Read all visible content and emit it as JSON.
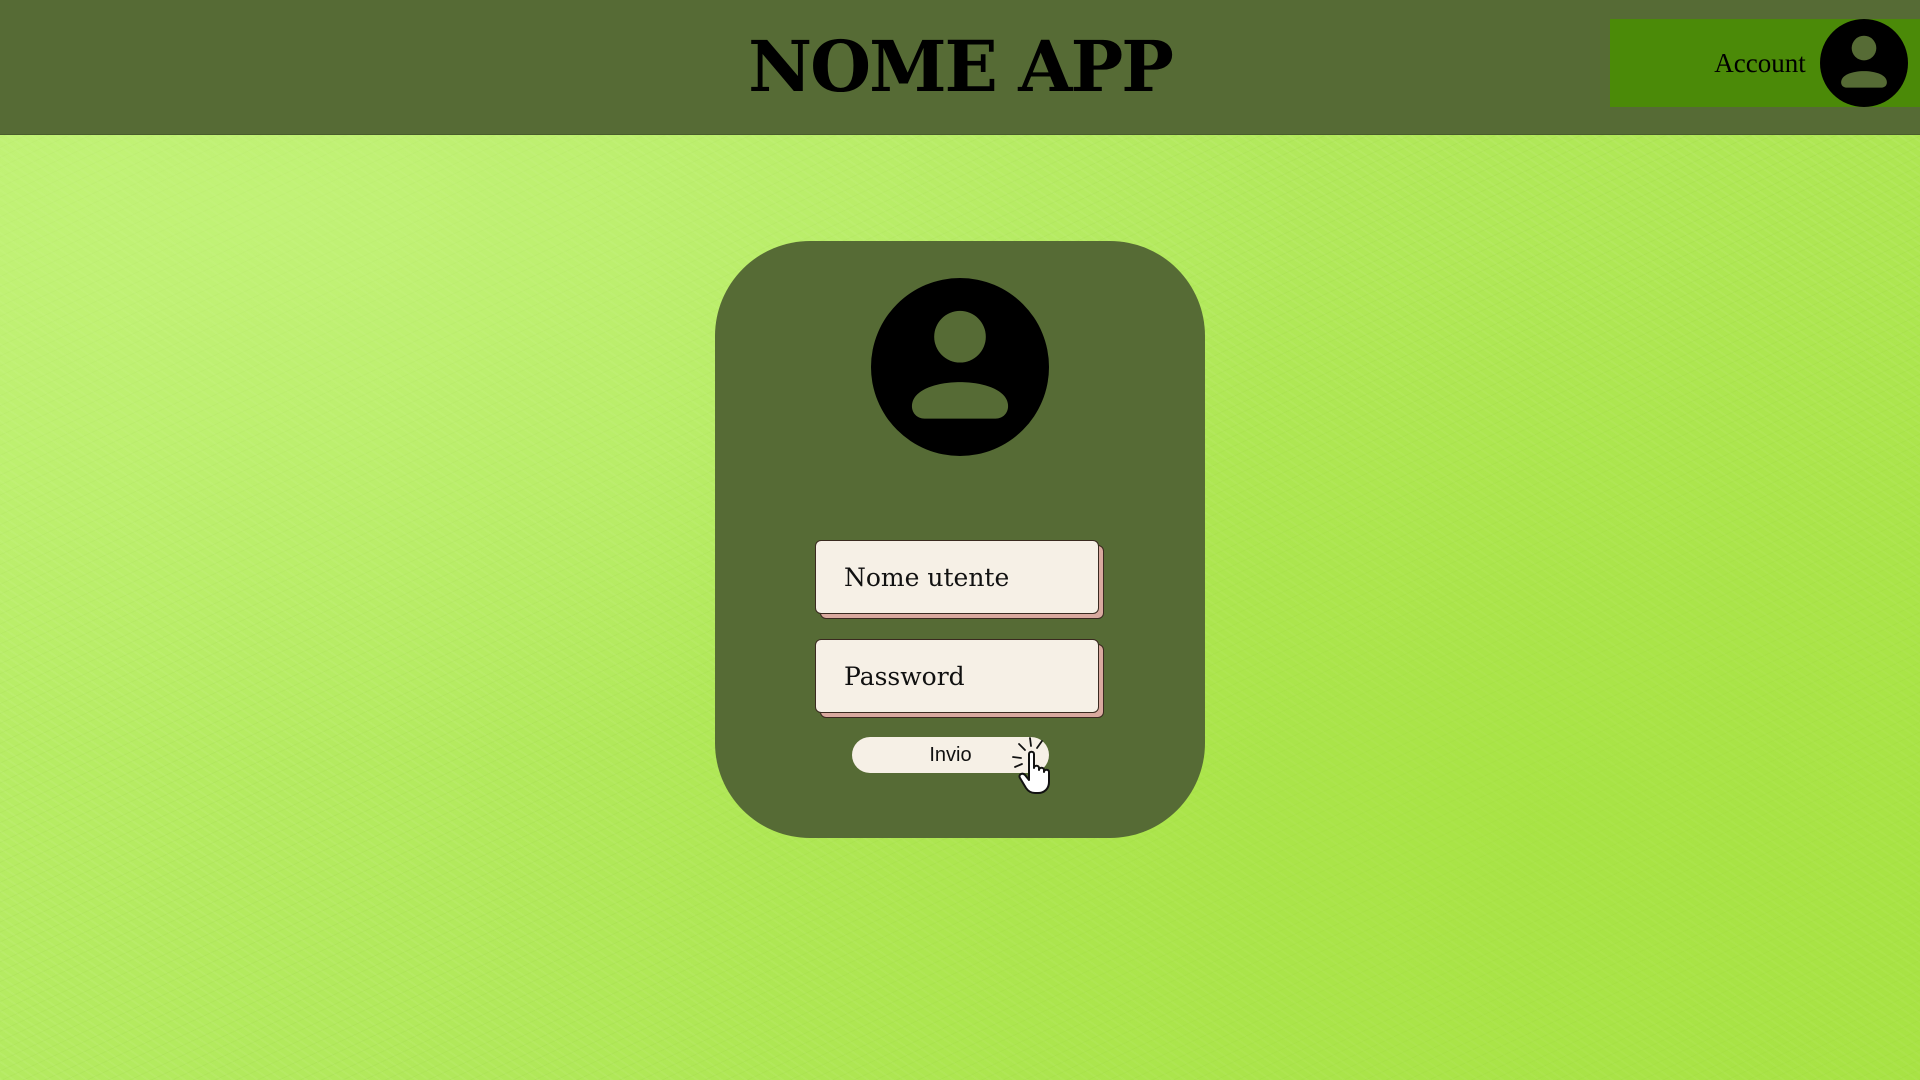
{
  "header": {
    "app_title": "NOME APP",
    "account_label": "Account",
    "account_icon": "user-avatar-icon"
  },
  "login": {
    "avatar_icon": "user-avatar-icon",
    "username_placeholder": "Nome utente",
    "password_placeholder": "Password",
    "submit_label": "Invio",
    "cursor_icon": "pointer-hand-click-icon"
  },
  "colors": {
    "background": "#b3e65a",
    "header_bg": "#566b35",
    "card_bg": "#566b35",
    "account_bg": "#4b8a08",
    "field_bg": "#f6f0e6",
    "field_shadow": "#d9a99f"
  }
}
